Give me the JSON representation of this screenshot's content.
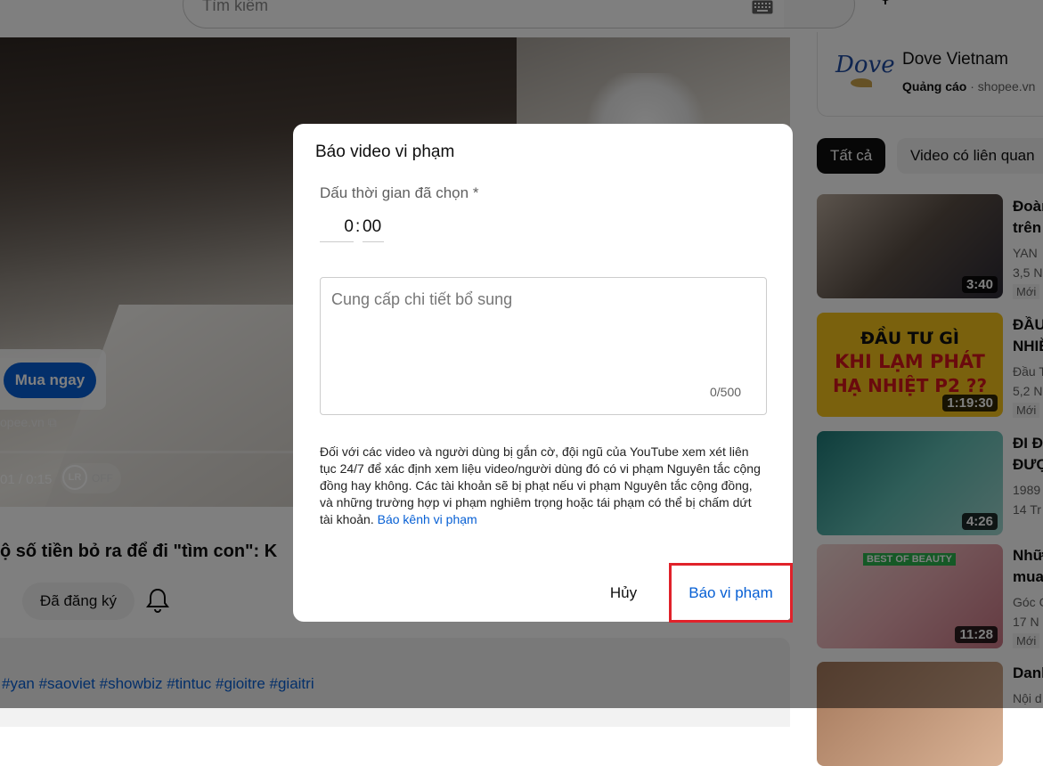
{
  "header": {
    "search_placeholder": "Tìm kiếm"
  },
  "player": {
    "buy_button": "Mua ngay",
    "ad_domain": "opee.vn",
    "time": "01 / 0:15",
    "lr_badge": "LR",
    "lr_state": "OFF"
  },
  "video": {
    "title": "ộ số tiền bỏ ra để đi \"tìm con\": K",
    "subscribed_label": "Đã đăng ký",
    "hashtags": "#yan #saoviet #showbiz #tintuc #gioitre #giaitri"
  },
  "sidebar": {
    "ad": {
      "logo": "Dove",
      "name": "Dove Vietnam",
      "label": "Quảng cáo",
      "domain": " · shopee.vn"
    },
    "chips": [
      "Tất cả",
      "Video có liên quan"
    ],
    "videos": [
      {
        "title1": "Đoàn",
        "title2": "trên",
        "meta1": "YAN",
        "meta2": "3,5 N",
        "badge": "Mới",
        "duration": "3:40"
      },
      {
        "title1": "ĐẦU",
        "title2": "NHIỀ",
        "meta1": "Đầu T",
        "meta2": "5,2 N",
        "badge": "Mới",
        "duration": "1:19:30",
        "thumb_lines": [
          "ĐẦU TƯ GÌ",
          "KHI LẠM PHÁT",
          "HẠ NHIỆT P2 ??"
        ]
      },
      {
        "title1": "ĐI Đ",
        "title2": "ĐƯỢ",
        "meta1": "1989",
        "meta2": "14 Tr",
        "badge": "",
        "duration": "4:26"
      },
      {
        "title1": "Nhữ",
        "title2": "mua",
        "meta1": "Góc C",
        "meta2": "17 N",
        "badge": "Mới",
        "duration": "11:28",
        "thumb_badge": "BEST OF BEAUTY"
      },
      {
        "title1": "Danh",
        "title2": "",
        "meta1": "Nội d",
        "meta2": "",
        "badge": "",
        "duration": ""
      }
    ]
  },
  "dialog": {
    "title": "Báo video vi phạm",
    "timestamp_label": "Dấu thời gian đã chọn *",
    "minutes": "0",
    "separator": ":",
    "seconds": "00",
    "details_placeholder": "Cung cấp chi tiết bổ sung",
    "char_count": "0/500",
    "policy_text": "Đối với các video và người dùng bị gắn cờ, đội ngũ của YouTube xem xét liên tục 24/7 để xác định xem liệu video/người dùng đó có vi phạm Nguyên tắc cộng đồng hay không. Các tài khoản sẽ bị phạt nếu vi phạm Nguyên tắc cộng đồng, và những trường hợp vi phạm nghiêm trọng hoặc tái phạm có thể bị chấm dứt tài khoản.",
    "policy_link": "Báo kênh vi phạm",
    "cancel_label": "Hủy",
    "report_label": "Báo vi phạm"
  },
  "colors": {
    "link_blue": "#065fd4",
    "highlight_red": "#e0222a",
    "overlay": "rgba(0,0,0,0.5)"
  }
}
